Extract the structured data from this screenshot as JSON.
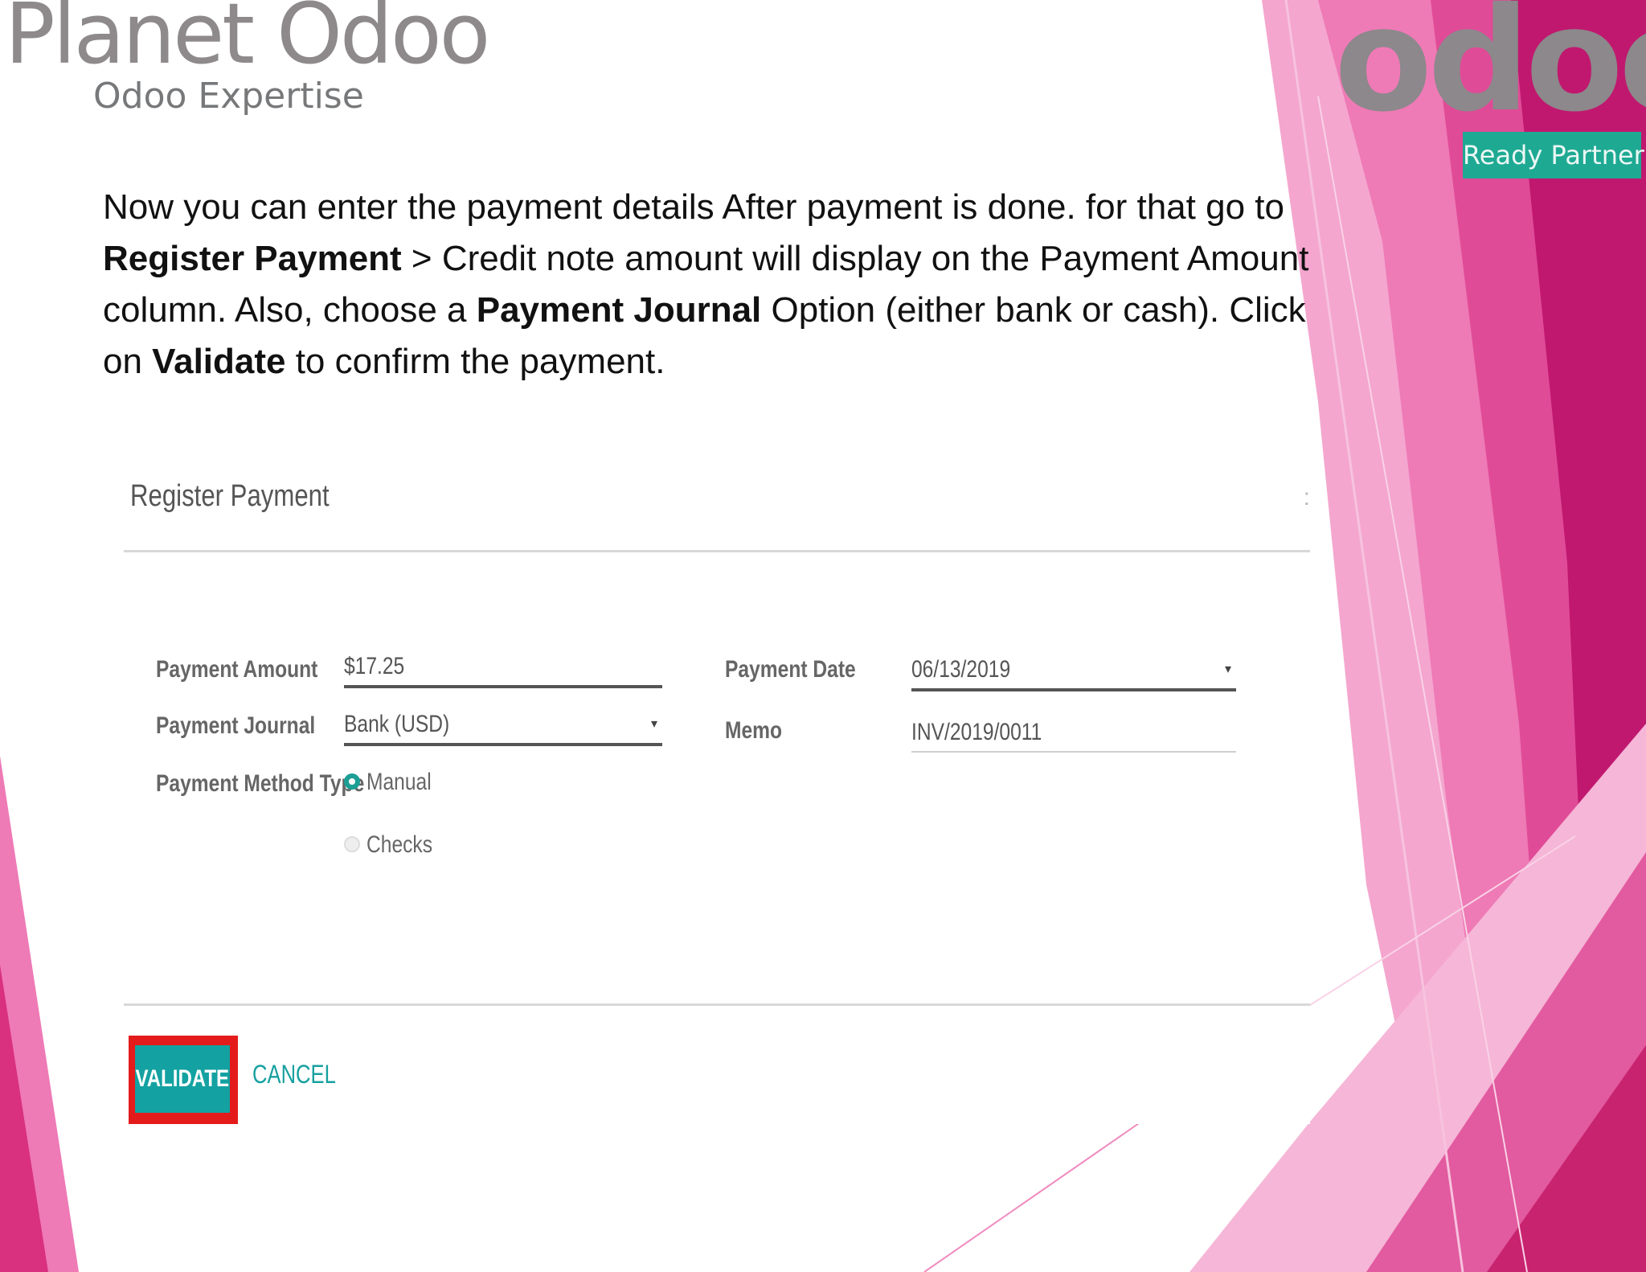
{
  "branding": {
    "planet_logo_title": "Planet Odoo",
    "planet_logo_subtitle": "Odoo Expertise",
    "odoo_logo_word": "odoo",
    "odoo_badge": "Ready Partner"
  },
  "instructions": {
    "part1": "Now you can enter the payment details After payment is done. for that go to ",
    "bold1": "Register Payment",
    "part2": " > Credit note amount will display on the Payment Amount column. Also, choose a ",
    "bold2": "Payment Journal",
    "part3": " Option (either bank or cash). Click on ",
    "bold3": "Validate",
    "part4": " to confirm the payment."
  },
  "dialog": {
    "title": "Register Payment",
    "fields": {
      "payment_amount": {
        "label": "Payment Amount",
        "value": "$17.25"
      },
      "payment_journal": {
        "label": "Payment Journal",
        "value": "Bank (USD)"
      },
      "payment_method_type": {
        "label": "Payment Method Type",
        "options": [
          "Manual",
          "Checks"
        ],
        "selected": "Manual"
      },
      "payment_date": {
        "label": "Payment Date",
        "value": "06/13/2019"
      },
      "memo": {
        "label": "Memo",
        "value": "INV/2019/0011"
      }
    },
    "buttons": {
      "validate": "VALIDATE",
      "cancel": "CANCEL"
    }
  },
  "icons": {
    "close": "close-icon",
    "dropdown": "caret-down-icon",
    "radio_selected": "radio-selected-icon",
    "radio_unselected": "radio-unselected-icon"
  },
  "colors": {
    "accent_teal": "#14a1a1",
    "highlight_red": "#e41b1b",
    "badge_green": "#1ea993",
    "magenta": "#c0186f",
    "pink": "#ee7ab6"
  }
}
